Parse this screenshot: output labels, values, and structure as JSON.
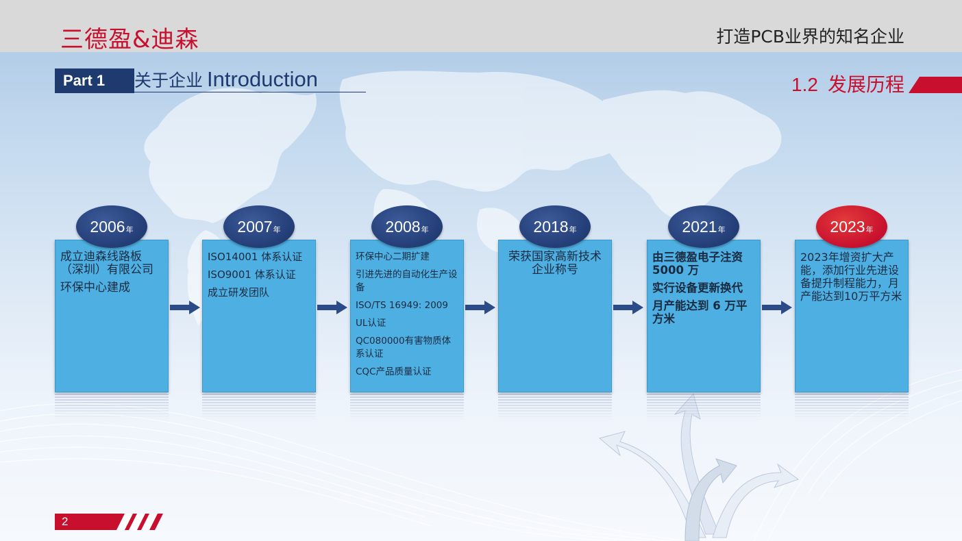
{
  "header": {
    "brand": "三德盈&迪森",
    "slogan": "打造PCB业界的知名企业"
  },
  "part": {
    "tag": "Part 1",
    "title_cn": "关于企业",
    "title_en": "Introduction"
  },
  "section": {
    "number": "1.2",
    "title": "发展历程"
  },
  "timeline": [
    {
      "year": "2006",
      "suffix": "年",
      "highlight": false,
      "lines": [
        "成立迪森线路板（深圳）有限公司",
        "环保中心建成"
      ]
    },
    {
      "year": "2007",
      "suffix": "年",
      "highlight": false,
      "lines": [
        "ISO14001 体系认证",
        "ISO9001 体系认证",
        "成立研发团队"
      ]
    },
    {
      "year": "2008",
      "suffix": "年",
      "highlight": false,
      "lines": [
        "环保中心二期扩建",
        "引进先进的自动化生产设备",
        "ISO/TS 16949: 2009",
        "UL认证",
        "QC080000有害物质体系认证",
        "CQC产品质量认证"
      ]
    },
    {
      "year": "2018",
      "suffix": "年",
      "highlight": false,
      "lines": [
        "荣获国家高新技术企业称号"
      ]
    },
    {
      "year": "2021",
      "suffix": "年",
      "highlight": false,
      "lines": [
        "由三德盈电子注资5000 万",
        "实行设备更新换代",
        "月产能达到 6 万平方米"
      ]
    },
    {
      "year": "2023",
      "suffix": "年",
      "highlight": true,
      "lines": [
        "2023年增资扩大产能，添加行业先进设备提升制程能力，月产能达到10万平方米"
      ]
    }
  ],
  "footer": {
    "page_number": "2"
  },
  "colors": {
    "brand_red": "#c8102e",
    "navy": "#1f3a6e",
    "card_blue": "#4eb0e2"
  }
}
